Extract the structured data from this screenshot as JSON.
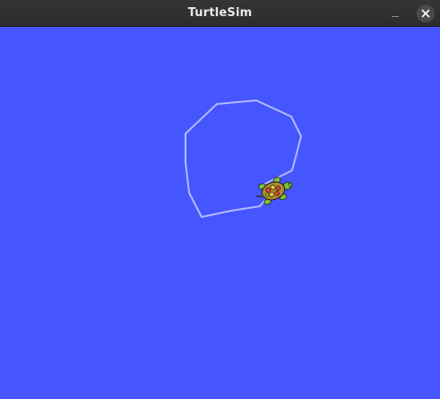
{
  "window": {
    "title": "TurtleSim"
  },
  "controls": {
    "minimize_icon": "minimize-icon",
    "close_icon": "close-icon"
  },
  "canvas": {
    "background_color": "#4556ff",
    "pen_color": "#b3b8ff",
    "turtle_icon": "turtle-icon"
  }
}
